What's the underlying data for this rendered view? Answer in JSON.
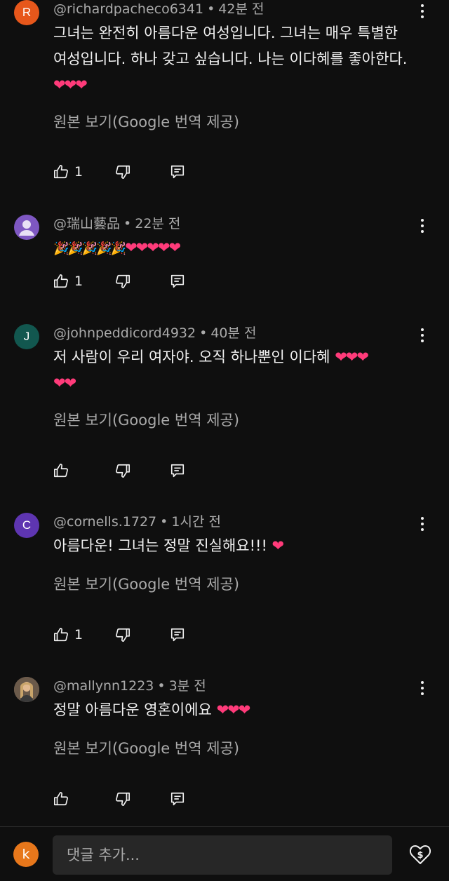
{
  "comments": [
    {
      "avatar_letter": "R",
      "avatar_color": "#e7571b",
      "author": "@richardpacheco6341",
      "time": "42분 전",
      "text_lines": [
        "그녀는 완전히 아름다운 여성입니다. 그녀는 매우 특별한",
        "여성입니다. 하나 갖고 싶습니다. 나는 이다혜를 좋아한다."
      ],
      "text_emoji": "❤❤❤",
      "translate_label": "원본 보기(Google 번역 제공)",
      "likes": "1"
    },
    {
      "avatar_letter": "",
      "avatar_color": "#7e57c2",
      "author": "@瑞山藝品",
      "time": "22분 전",
      "text_emoji_party": "🎉🎉🎉🎉🎉",
      "text_emoji": "❤❤❤❤❤",
      "likes": "1"
    },
    {
      "avatar_letter": "J",
      "avatar_color": "#12574f",
      "author": "@johnpeddicord4932",
      "time": "40분 전",
      "text_lines": [
        "저 사람이 우리 여자야. 오직 하나뿐인 이다혜"
      ],
      "text_emoji": "❤❤❤",
      "text_emoji_line2": "❤❤",
      "translate_label": "원본 보기(Google 번역 제공)",
      "likes": ""
    },
    {
      "avatar_letter": "C",
      "avatar_color": "#5e35b1",
      "author": "@cornells.1727",
      "time": "1시간 전",
      "text_lines": [
        "아름다운! 그녀는 정말 진실해요!!!"
      ],
      "text_emoji": "❤",
      "translate_label": "원본 보기(Google 번역 제공)",
      "likes": "1"
    },
    {
      "avatar_letter": "",
      "avatar_color": "#8a7a6a",
      "author": "@mallynn1223",
      "time": "3분 전",
      "text_lines": [
        "정말 아름다운 영혼이에요"
      ],
      "text_emoji": "❤❤❤",
      "translate_label": "원본 보기(Google 번역 제공)",
      "likes": ""
    }
  ],
  "footer": {
    "avatar_letter": "k",
    "avatar_color": "#e7771b",
    "placeholder": "댓글 추가..."
  },
  "colors": {
    "background": "#0f0f0f",
    "text": "#f1f1f1",
    "secondary": "#aaaaaa",
    "heart": "#ff3b7a"
  },
  "icons": [
    "like-icon",
    "dislike-icon",
    "reply-icon",
    "more-vert-icon",
    "thanks-icon",
    "default-avatar-icon"
  ]
}
